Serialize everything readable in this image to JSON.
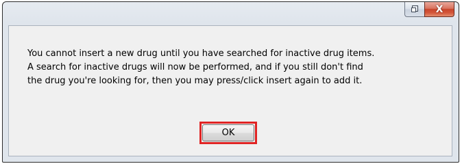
{
  "dialog": {
    "title": "",
    "message_lines": [
      "You cannot insert a new drug until you have searched for inactive drug items.",
      "A search for inactive drugs will now be performed, and if you still don't find",
      "the drug you're looking for, then you may press/click insert again to add it."
    ],
    "ok_label": "OK",
    "highlight_color": "#e02424"
  },
  "title_bar": {
    "buttons": [
      {
        "icon": "restore-icon"
      },
      {
        "icon": "close-icon",
        "glyph": "X"
      }
    ]
  }
}
